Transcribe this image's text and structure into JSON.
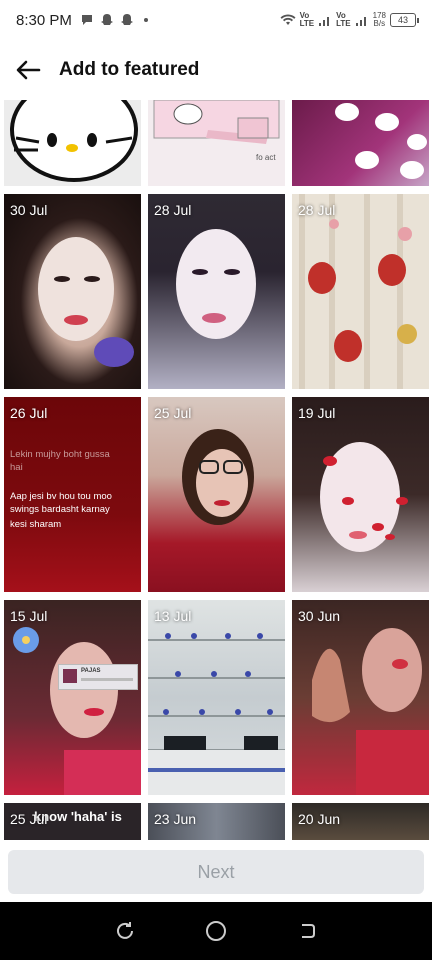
{
  "status_bar": {
    "time": "8:30 PM",
    "net1": [
      "Vo",
      "LTE"
    ],
    "net2": [
      "Vo",
      "LTE"
    ],
    "speed_value": "178",
    "speed_unit": "B/s",
    "battery": "43"
  },
  "header": {
    "title": "Add to featured",
    "back_icon": "arrow-left-icon"
  },
  "tiles": [
    {
      "date": ""
    },
    {
      "date": ""
    },
    {
      "date": ""
    },
    {
      "date": "30 Jul"
    },
    {
      "date": "28 Jul"
    },
    {
      "date": "28 Jul"
    },
    {
      "date": "26 Jul",
      "text_line1": "Lekin mujhy boht gussa",
      "text_line2": "hai",
      "text_line3": "Aap jesi bv hou tou moo",
      "text_line4": "swings bardasht karnay",
      "text_line5": "kesi sharam"
    },
    {
      "date": "25 Jul"
    },
    {
      "date": "19 Jul"
    },
    {
      "date": "15 Jul",
      "card_title": "PAJAS"
    },
    {
      "date": "13 Jul"
    },
    {
      "date": "30 Jun"
    },
    {
      "date": "25 Jul",
      "overlay": "know 'haha' is"
    },
    {
      "date": "23 Jun"
    },
    {
      "date": "20 Jun"
    }
  ],
  "top_tile_caption": "fo act",
  "next_label": "Next",
  "nav": {
    "recent": "recent-apps-icon",
    "home": "home-icon",
    "back": "back-icon"
  },
  "colors": {
    "accent_disabled": "#e6e8eb",
    "nav_bg": "#000000"
  }
}
